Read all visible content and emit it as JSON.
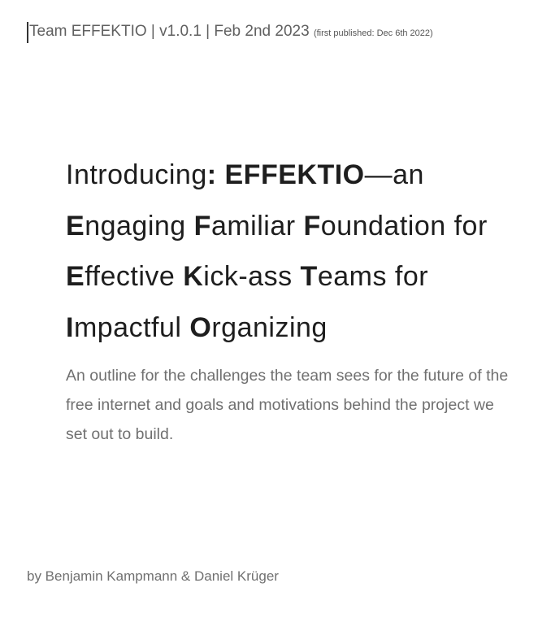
{
  "header": {
    "main": "Team EFFEKTIO | v1.0.1 | Feb 2nd 2023",
    "note": "(first published: Dec 6th 2022)"
  },
  "title": {
    "line1": [
      {
        "text": "Introducing",
        "bold": false
      },
      {
        "text": ": EFFEKTIO",
        "bold": true
      },
      {
        "text": "—an",
        "bold": false
      }
    ],
    "line2": [
      {
        "text": "E",
        "bold": true
      },
      {
        "text": "ngaging ",
        "bold": false
      },
      {
        "text": "F",
        "bold": true
      },
      {
        "text": "amiliar ",
        "bold": false
      },
      {
        "text": "F",
        "bold": true
      },
      {
        "text": "oundation for",
        "bold": false
      }
    ],
    "line3": [
      {
        "text": "E",
        "bold": true
      },
      {
        "text": "ffective ",
        "bold": false
      },
      {
        "text": "K",
        "bold": true
      },
      {
        "text": "ick-ass ",
        "bold": false
      },
      {
        "text": "T",
        "bold": true
      },
      {
        "text": "eams for",
        "bold": false
      }
    ],
    "line4": [
      {
        "text": "I",
        "bold": true
      },
      {
        "text": "mpactful ",
        "bold": false
      },
      {
        "text": "O",
        "bold": true
      },
      {
        "text": "rganizing",
        "bold": false
      }
    ]
  },
  "subtitle": "An outline for the challenges the team sees for the future of the free internet and goals and motivations behind the project we set out to build.",
  "byline": "by Benjamin Kampmann & Daniel Krüger"
}
